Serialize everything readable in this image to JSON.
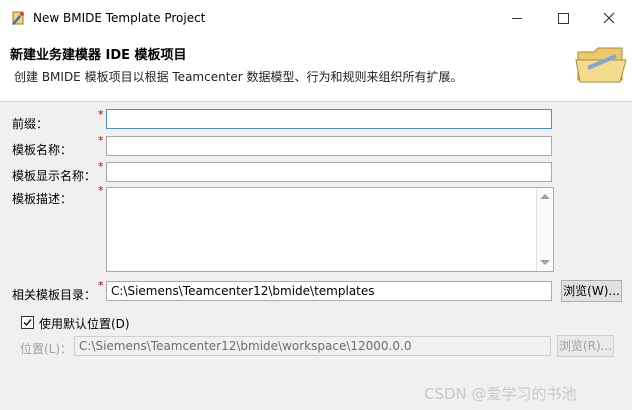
{
  "window": {
    "title": "New BMIDE Template Project"
  },
  "banner": {
    "title": "新建业务建模器 IDE 模板项目",
    "description": "创建 BMIDE 模板项目以根据 Teamcenter 数据模型、行为和规则来组织所有扩展。"
  },
  "form": {
    "prefix_label": "前缀：",
    "prefix_value": "",
    "template_name_label": "模板名称：",
    "template_name_value": "",
    "display_name_label": "模板显示名称：",
    "display_name_value": "",
    "description_label": "模板描述：",
    "description_value": "",
    "dir_label": "相关模板目录：",
    "dir_value": "C:\\Siemens\\Teamcenter12\\bmide\\templates",
    "browse_label": "浏览(W)...",
    "required_mark": "*",
    "use_default_label": "使用默认位置(D)",
    "use_default_checked": true,
    "location_label": "位置(L)：",
    "location_value": "C:\\Siemens\\Teamcenter12\\bmide\\workspace\\12000.0.0",
    "location_browse_label": "浏览(R)..."
  },
  "watermark": "CSDN @爱学习的书池",
  "colors": {
    "required": "#c00000",
    "focus_border": "#4a90d9",
    "disabled_text": "#a0a0a0"
  }
}
